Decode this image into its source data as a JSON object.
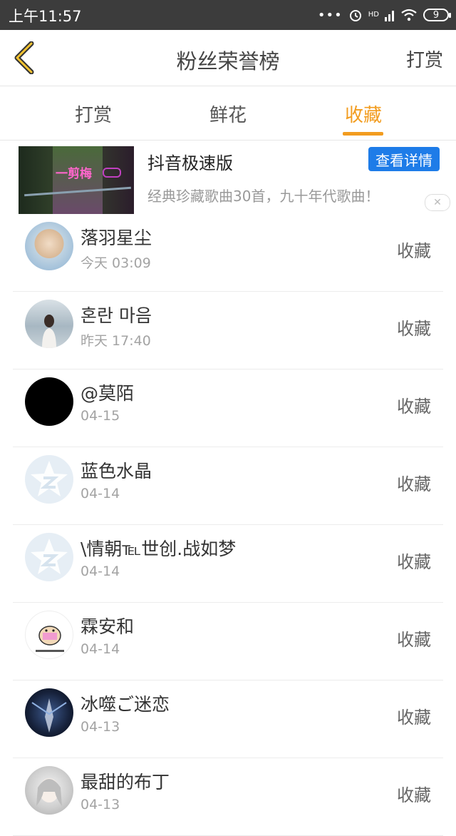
{
  "status_bar": {
    "time": "上午11:57",
    "signal_dots": "•••",
    "network_label": "HD",
    "battery": "9"
  },
  "header": {
    "title": "粉丝荣誉榜",
    "action_label": "打赏"
  },
  "tabs": [
    {
      "label": "打赏",
      "active": false
    },
    {
      "label": "鲜花",
      "active": false
    },
    {
      "label": "收藏",
      "active": true
    }
  ],
  "ad": {
    "title": "抖音极速版",
    "description": "经典珍藏歌曲30首，九十年代歌曲！",
    "button_label": "查看详情",
    "thumb_text": "一剪梅",
    "close_glyph": "✕"
  },
  "fans": [
    {
      "name": "落羽星尘",
      "time": "今天 03:09",
      "action": "收藏",
      "avatar": "photo"
    },
    {
      "name": "혼란 마음",
      "time": "昨天 17:40",
      "action": "收藏",
      "avatar": "sea-girl"
    },
    {
      "name": "@莫陌",
      "time": "04-15",
      "action": "收藏",
      "avatar": "black"
    },
    {
      "name": "蓝色水晶",
      "time": "04-14",
      "action": "收藏",
      "avatar": "qzone-default"
    },
    {
      "name": "\\情朝℡世创.战如梦",
      "time": "04-14",
      "action": "收藏",
      "avatar": "qzone-default"
    },
    {
      "name": "霖安和",
      "time": "04-14",
      "action": "收藏",
      "avatar": "cartoon-mouse"
    },
    {
      "name": "冰噬ご迷恋",
      "time": "04-13",
      "action": "收藏",
      "avatar": "night-figure"
    },
    {
      "name": "最甜的布丁",
      "time": "04-13",
      "action": "收藏",
      "avatar": "anime-girl"
    }
  ],
  "colors": {
    "accent": "#f29c1f",
    "ad_button": "#1e7ce8",
    "status_bar": "#3c3c3c"
  }
}
